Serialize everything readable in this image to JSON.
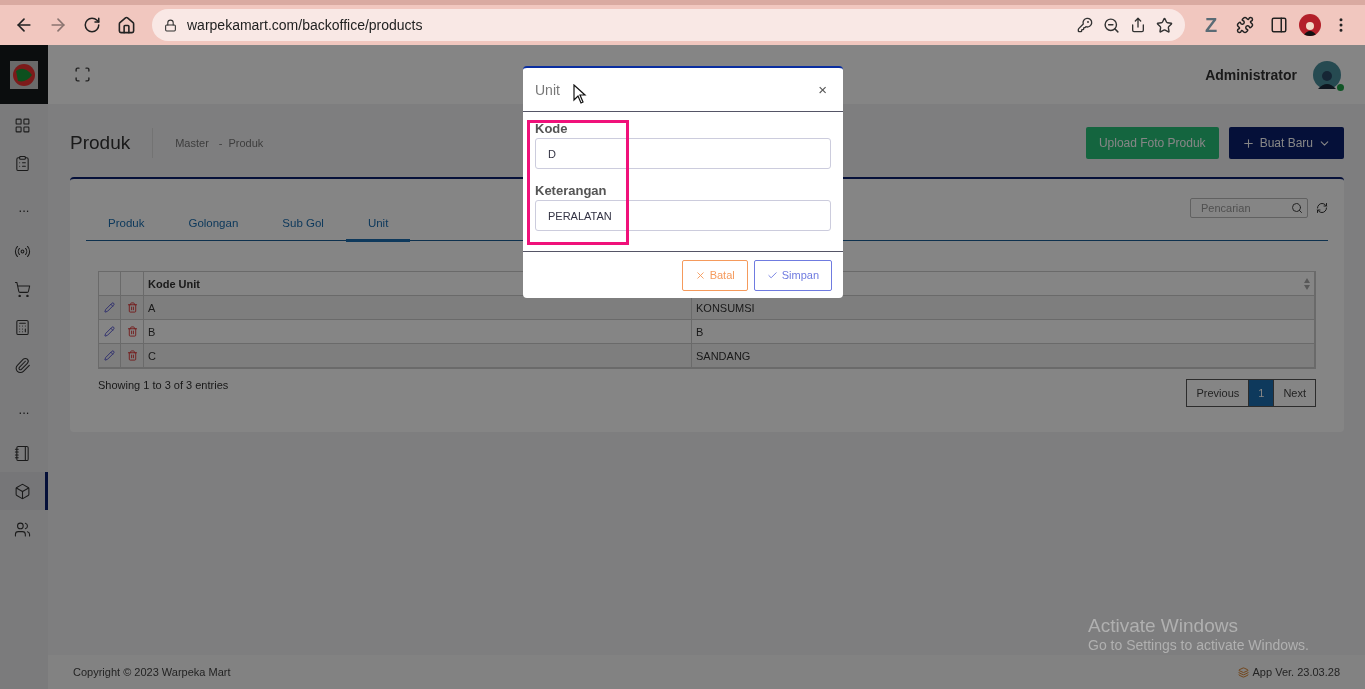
{
  "browser": {
    "url": "warpekamart.com/backoffice/products",
    "extension_letter": "Z"
  },
  "topbar": {
    "user": "Administrator"
  },
  "sidebar": {
    "items": [
      {
        "kind": "link",
        "selected": false
      },
      {
        "kind": "link",
        "selected": false
      },
      {
        "kind": "separator",
        "text": "..."
      },
      {
        "kind": "link",
        "selected": false
      },
      {
        "kind": "link",
        "selected": false
      },
      {
        "kind": "link",
        "selected": false
      },
      {
        "kind": "link",
        "selected": false
      },
      {
        "kind": "separator",
        "text": "..."
      },
      {
        "kind": "link",
        "selected": false
      },
      {
        "kind": "link",
        "selected": true
      },
      {
        "kind": "link",
        "selected": false
      }
    ]
  },
  "page": {
    "title": "Produk",
    "breadcrumb": [
      "Master",
      "Produk"
    ],
    "breadcrumb_separator": "-",
    "buttons": [
      {
        "label": "Upload Foto Produk",
        "kind": "upload"
      },
      {
        "label": "Buat Baru",
        "kind": "create"
      }
    ]
  },
  "tabs": [
    {
      "label": "Produk",
      "selected": false
    },
    {
      "label": "Golongan",
      "selected": false
    },
    {
      "label": "Sub Gol",
      "selected": false
    },
    {
      "label": "Unit",
      "selected": true
    }
  ],
  "search": {
    "placeholder": "Pencarian"
  },
  "table": {
    "columns": [
      "Kode Unit"
    ],
    "rows": [
      {
        "code": "A",
        "column_2": "KONSUMSI"
      },
      {
        "code": "B",
        "column_2": "B"
      },
      {
        "code": "C",
        "column_2": "SANDANG"
      }
    ],
    "info": "Showing 1 to 3 of 3 entries",
    "pagination": [
      {
        "label": "Previous",
        "selected": false
      },
      {
        "label": "1",
        "selected": true
      },
      {
        "label": "Next",
        "selected": false
      }
    ]
  },
  "footer": {
    "copyright": "Copyright © 2023 Warpeka Mart",
    "version": "App Ver. 23.03.28"
  },
  "os_notice": {
    "title": "Activate Windows",
    "text": "Go to Settings to activate Windows."
  },
  "modal": {
    "title": "Unit",
    "close": "×",
    "fields": [
      {
        "label": "Kode",
        "value": "D"
      },
      {
        "label": "Keterangan",
        "value": "PERALATAN"
      }
    ],
    "buttons": [
      {
        "label": "Batal",
        "kind": "cancel"
      },
      {
        "label": "Simpan",
        "kind": "save"
      }
    ]
  }
}
